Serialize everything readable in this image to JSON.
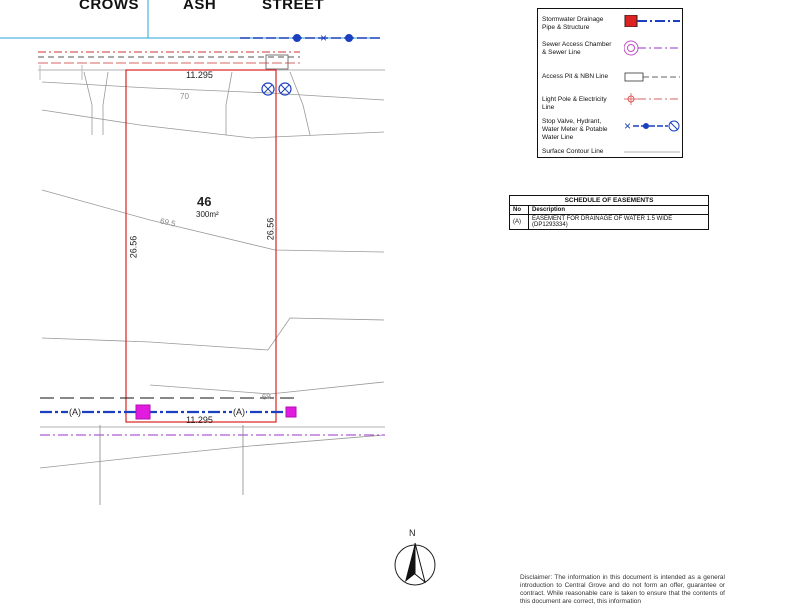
{
  "streets": [
    "CROWS",
    "ASH",
    "STREET"
  ],
  "lot": {
    "number": "46",
    "area": "300m²"
  },
  "dimensions": {
    "frontage_top": "11.295",
    "frontage_bottom": "11.295",
    "side_left": "26.56",
    "side_right": "26.56"
  },
  "contours": [
    "70",
    "69.5",
    "69"
  ],
  "easement_markers": [
    "(A)",
    "(A)"
  ],
  "north_label": "N",
  "legend": [
    {
      "label": "Stormwater Drainage Pipe & Structure",
      "icon": "stormwater-drainage-icon"
    },
    {
      "label": "Sewer Access Chamber & Sewer Line",
      "icon": "sewer-chamber-icon"
    },
    {
      "label": "Access Pit & NBN Line",
      "icon": "access-pit-icon"
    },
    {
      "label": "Light Pole & Electricity Line",
      "icon": "light-pole-icon"
    },
    {
      "label": "Stop Valve, Hydrant, Water Meter & Potable Water Line",
      "icon": "water-valve-icon"
    },
    {
      "label": "Surface Contour Line",
      "icon": "contour-line-icon"
    }
  ],
  "easements": {
    "title": "SCHEDULE OF EASEMENTS",
    "headers": [
      "No",
      "Description"
    ],
    "rows": [
      {
        "no": "(A)",
        "description": "EASEMENT FOR DRAINAGE OF WATER 1.5 WIDE (DP1293334)"
      }
    ]
  },
  "disclaimer": "Disclaimer: The information in this document is intended as a general introduction to Central Grove and do not form an offer, guarantee or contract. While reasonable care is taken to ensure that the contents of this document are correct, this information"
}
